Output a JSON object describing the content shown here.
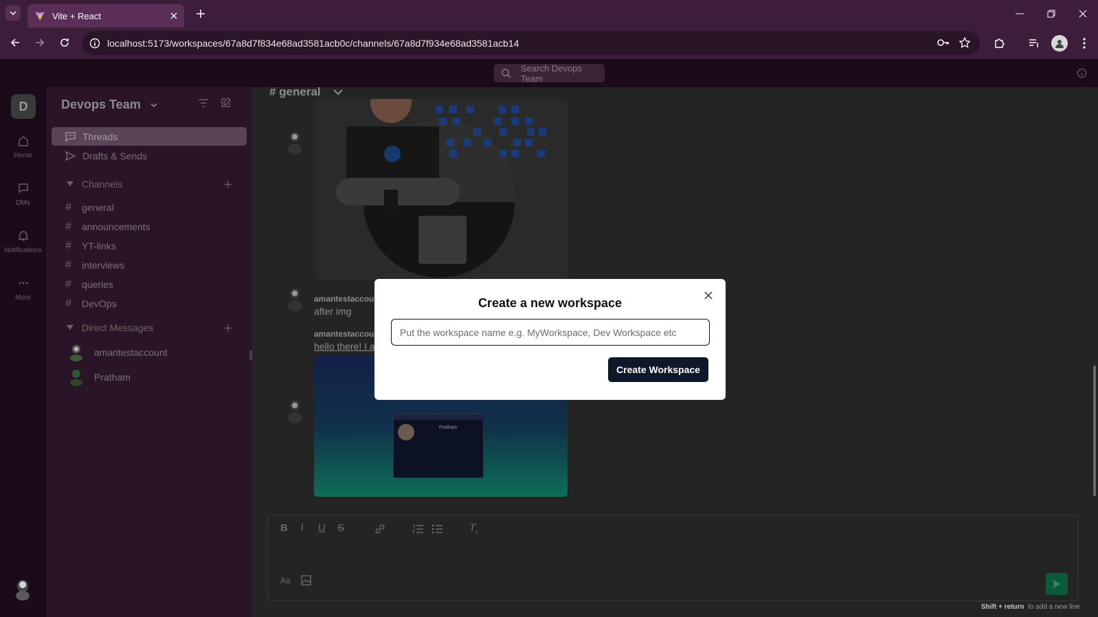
{
  "browser": {
    "tab_title": "Vite + React",
    "url": "localhost:5173/workspaces/67a8d7f834e68ad3581acb0c/channels/67a8d7f934e68ad3581acb14"
  },
  "topbar": {
    "search_placeholder": "Search Devops Team"
  },
  "rail": {
    "workspace_initial": "D",
    "items": [
      {
        "label": "Home",
        "icon": "home-icon"
      },
      {
        "label": "DMs",
        "icon": "chat-icon"
      },
      {
        "label": "Notifications",
        "icon": "bell-icon"
      },
      {
        "label": "More",
        "icon": "more-icon"
      }
    ]
  },
  "sidebar": {
    "workspace_name": "Devops Team",
    "threads": "Threads",
    "drafts": "Drafts & Sends",
    "channels_header": "Channels",
    "channels": [
      "general",
      "announcements",
      "YT-links",
      "interviews",
      "queries",
      "DevOps"
    ],
    "dms_header": "Direct Messages",
    "dms": [
      "amantestaccount",
      "Pratham"
    ]
  },
  "channel": {
    "name": "# general",
    "messages": [
      {
        "author": "amantestaccount",
        "text": "after img"
      },
      {
        "author": "amantestaccount",
        "text": "hello there! I a"
      }
    ],
    "shot_card_name": "Pratham"
  },
  "composer": {
    "format_hint": "Aa",
    "hint_key": "Shift + return",
    "hint_text": "to add a new line"
  },
  "modal": {
    "title": "Create a new workspace",
    "input_placeholder": "Put the workspace name e.g. MyWorkspace, Dev Workspace etc",
    "input_value": "",
    "submit_label": "Create Workspace"
  }
}
